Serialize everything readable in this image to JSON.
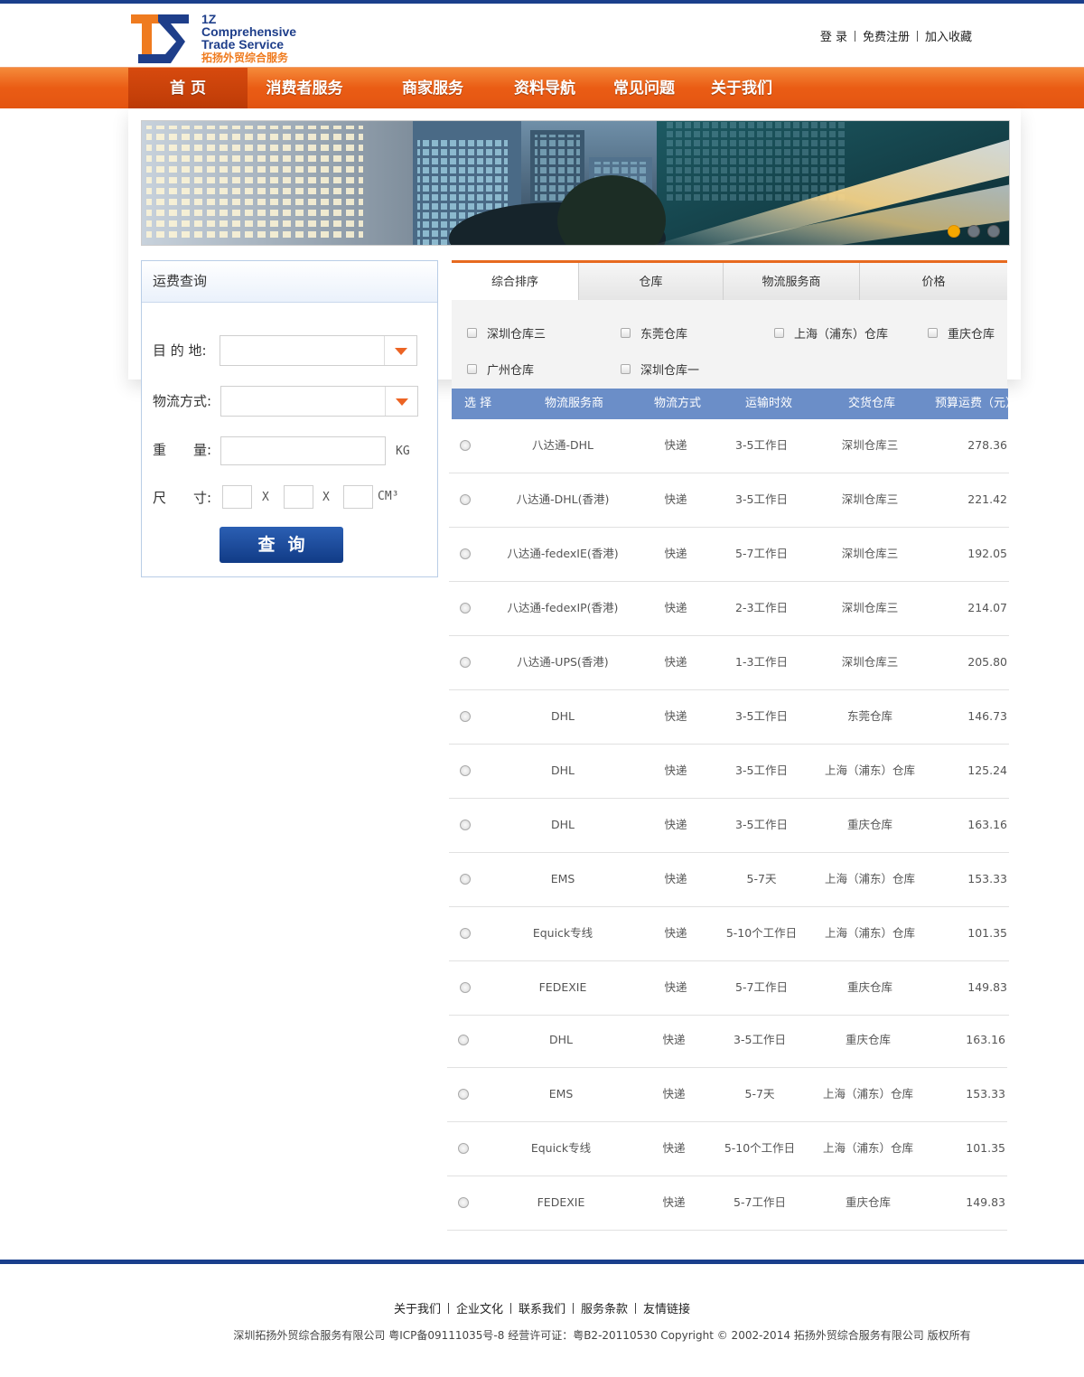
{
  "header": {
    "logo": {
      "line1": "1Z",
      "line2": "Comprehensive",
      "line3": "Trade Service",
      "line4": "拓扬外贸综合服务"
    },
    "links": [
      "登 录",
      "免费注册",
      "加入收藏"
    ]
  },
  "nav": {
    "items": [
      "首 页",
      "消费者服务",
      "商家服务",
      "资料导航",
      "常见问题",
      "关于我们"
    ],
    "active_index": 0
  },
  "banner": {
    "slide_count": 3,
    "active_slide": 1
  },
  "query": {
    "title": "运费查询",
    "destination_label": "目 的 地:",
    "destination_value": "",
    "shipping_method_label": "物流方式:",
    "shipping_method_value": "",
    "weight_label": "重　　量:",
    "weight_value": "",
    "weight_unit": "KG",
    "size_label": "尺　　寸:",
    "size_values": [
      "",
      "",
      ""
    ],
    "size_separator": "X",
    "size_unit": "CM³",
    "submit_label": "查询"
  },
  "results": {
    "tabs": [
      "综合排序",
      "仓库",
      "物流服务商",
      "价格"
    ],
    "active_tab": 0,
    "filters": [
      "深圳仓库三",
      "东莞仓库",
      "上海（浦东）仓库",
      "重庆仓库",
      "广州仓库",
      "深圳仓库一"
    ],
    "columns": [
      "选 择",
      "物流服务商",
      "物流方式",
      "运输时效",
      "交货仓库",
      "预算运费（元）"
    ],
    "rows": [
      {
        "provider": "八达通-DHL",
        "method": "快递",
        "time": "3-5工作日",
        "warehouse": "深圳仓库三",
        "price": "278.36"
      },
      {
        "provider": "八达通-DHL(香港)",
        "method": "快递",
        "time": "3-5工作日",
        "warehouse": "深圳仓库三",
        "price": "221.42"
      },
      {
        "provider": "八达通-fedexIE(香港)",
        "method": "快递",
        "time": "5-7工作日",
        "warehouse": "深圳仓库三",
        "price": "192.05"
      },
      {
        "provider": "八达通-fedexIP(香港)",
        "method": "快递",
        "time": "2-3工作日",
        "warehouse": "深圳仓库三",
        "price": "214.07"
      },
      {
        "provider": "八达通-UPS(香港)",
        "method": "快递",
        "time": "1-3工作日",
        "warehouse": "深圳仓库三",
        "price": "205.80"
      },
      {
        "provider": "DHL",
        "method": "快递",
        "time": "3-5工作日",
        "warehouse": "东莞仓库",
        "price": "146.73"
      },
      {
        "provider": "DHL",
        "method": "快递",
        "time": "3-5工作日",
        "warehouse": "上海（浦东）仓库",
        "price": "125.24"
      },
      {
        "provider": "DHL",
        "method": "快递",
        "time": "3-5工作日",
        "warehouse": "重庆仓库",
        "price": "163.16"
      },
      {
        "provider": "EMS",
        "method": "快递",
        "time": "5-7天",
        "warehouse": "上海（浦东）仓库",
        "price": "153.33"
      },
      {
        "provider": "Equick专线",
        "method": "快递",
        "time": "5-10个工作日",
        "warehouse": "上海（浦东）仓库",
        "price": "101.35"
      },
      {
        "provider": "FEDEXIE",
        "method": "快递",
        "time": "5-7工作日",
        "warehouse": "重庆仓库",
        "price": "149.83"
      },
      {
        "provider": "DHL",
        "method": "快递",
        "time": "3-5工作日",
        "warehouse": "重庆仓库",
        "price": "163.16"
      },
      {
        "provider": "EMS",
        "method": "快递",
        "time": "5-7天",
        "warehouse": "上海（浦东）仓库",
        "price": "153.33"
      },
      {
        "provider": "Equick专线",
        "method": "快递",
        "time": "5-10个工作日",
        "warehouse": "上海（浦东）仓库",
        "price": "101.35"
      },
      {
        "provider": "FEDEXIE",
        "method": "快递",
        "time": "5-7工作日",
        "warehouse": "重庆仓库",
        "price": "149.83"
      }
    ]
  },
  "footer": {
    "links": [
      "关于我们",
      "企业文化",
      "联系我们",
      "服务条款",
      "友情链接"
    ],
    "copyright": "深圳拓扬外贸综合服务有限公司 粤ICP备09111035号-8 经营许可证：粤B2-20110530 Copyright © 2002-2014 拓扬外贸综合服务有限公司 版权所有"
  },
  "colors": {
    "brand_blue": "#1a3f8c",
    "nav_orange": "#ea5c14",
    "table_header": "#6b8ec8",
    "accent_orange": "#ef7b1f"
  }
}
